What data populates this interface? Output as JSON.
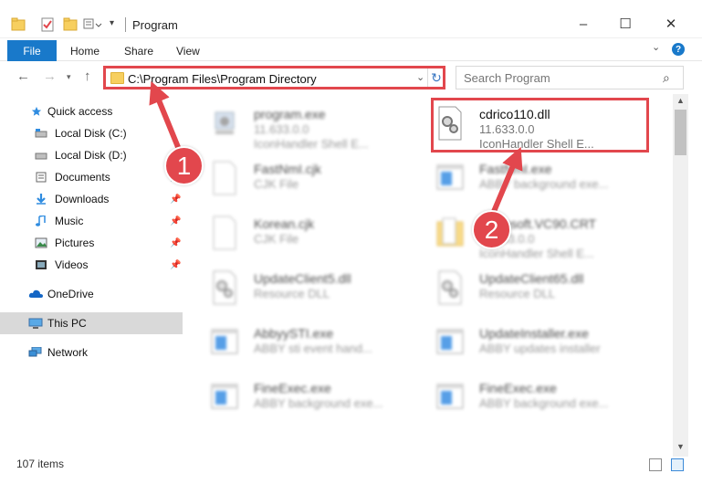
{
  "window": {
    "title": "Program",
    "minimize": "–",
    "maximize": "☐",
    "close": "✕"
  },
  "ribbon": {
    "tabs": [
      "File",
      "Home",
      "Share",
      "View"
    ]
  },
  "address": {
    "path": "C:\\Program Files\\Program Directory",
    "search_placeholder": "Search Program"
  },
  "sidebar": {
    "items": [
      {
        "label": "Quick access",
        "icon": "star-icon"
      },
      {
        "label": "Local Disk (C:)",
        "icon": "drive-icon"
      },
      {
        "label": "Local Disk (D:)",
        "icon": "drive-icon"
      },
      {
        "label": "Documents",
        "icon": "documents-icon",
        "pinned": true
      },
      {
        "label": "Downloads",
        "icon": "download-icon",
        "pinned": true
      },
      {
        "label": "Music",
        "icon": "music-icon",
        "pinned": true
      },
      {
        "label": "Pictures",
        "icon": "pictures-icon",
        "pinned": true
      },
      {
        "label": "Videos",
        "icon": "videos-icon",
        "pinned": true
      },
      {
        "label": "OneDrive",
        "icon": "cloud-icon"
      },
      {
        "label": "This PC",
        "icon": "computer-icon"
      },
      {
        "label": "Network",
        "icon": "network-icon"
      }
    ]
  },
  "files": [
    {
      "name": "program.exe",
      "l2": "11.633.0.0",
      "l3": "IconHandler Shell E...",
      "icon": "exe-icon"
    },
    {
      "name": "cdrico110.dll",
      "l2": "11.633.0.0",
      "l3": "IconHandler Shell E...",
      "icon": "dll-gear-icon"
    },
    {
      "name": "FastNmI.cjk",
      "l2": "CJK File",
      "l3": "",
      "icon": "blank-file-icon"
    },
    {
      "name": "FastNmI.exe",
      "l2": "ABBY background exe...",
      "l3": "",
      "icon": "window-exe-icon"
    },
    {
      "name": "Korean.cjk",
      "l2": "CJK File",
      "l3": "",
      "icon": "blank-file-icon"
    },
    {
      "name": "Microsoft.VC90.CRT",
      "l2": "11.633.0.0",
      "l3": "IconHandler Shell E...",
      "icon": "folder-icon"
    },
    {
      "name": "UpdateClient5.dll",
      "l2": "Resource DLL",
      "l3": "",
      "icon": "dll-gear-icon"
    },
    {
      "name": "UpdateClient65.dll",
      "l2": "Resource DLL",
      "l3": "",
      "icon": "dll-gear-icon"
    },
    {
      "name": "AbbyySTI.exe",
      "l2": "ABBY sti event hand...",
      "l3": "",
      "icon": "window-exe-icon"
    },
    {
      "name": "UpdateInstaller.exe",
      "l2": "ABBY updates installer",
      "l3": "",
      "icon": "window-exe-icon"
    },
    {
      "name": "FineExec.exe",
      "l2": "ABBY background exe...",
      "l3": "",
      "icon": "window-exe-icon"
    },
    {
      "name": "FineExec.exe",
      "l2": "ABBY background exe...",
      "l3": "",
      "icon": "window-exe-icon"
    }
  ],
  "status": {
    "item_count": "107 items"
  },
  "annotations": {
    "step1": "1",
    "step2": "2"
  },
  "colors": {
    "accent": "#1979ca",
    "highlight": "#e2474d",
    "selected_bg": "#d9d9d9"
  }
}
